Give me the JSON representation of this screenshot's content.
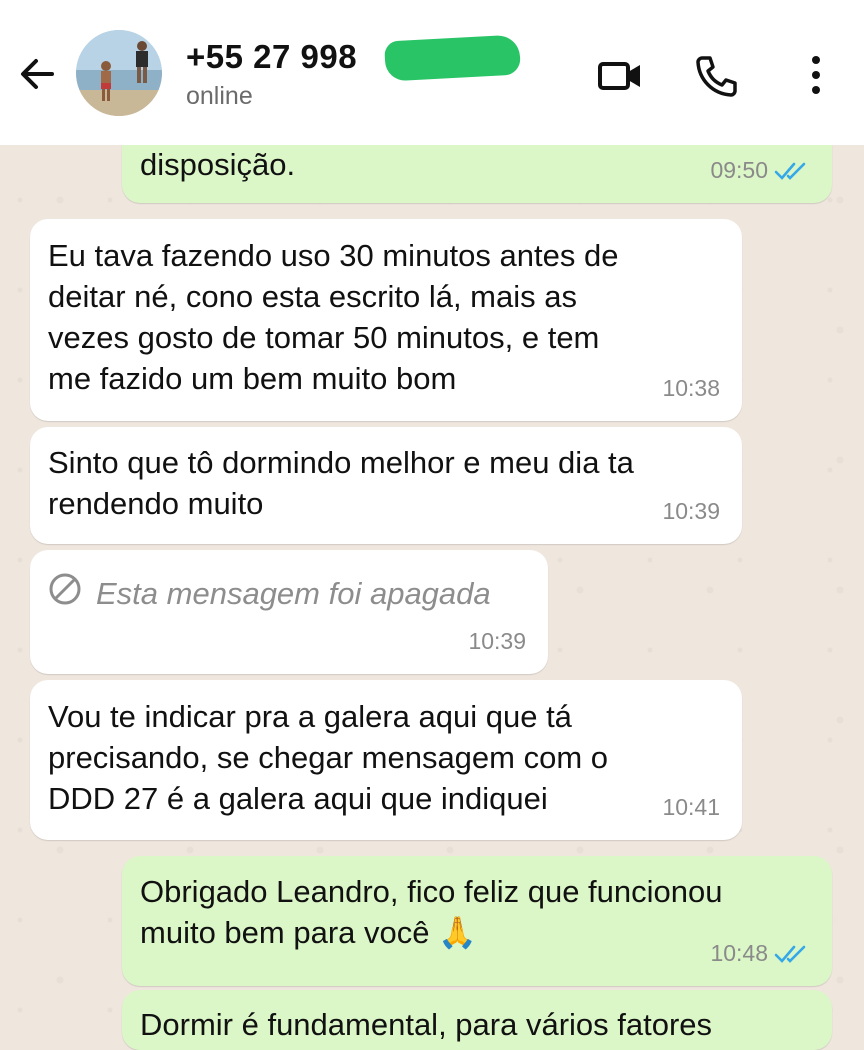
{
  "header": {
    "contact_name": "+55 27 998",
    "status": "online"
  },
  "messages": [
    {
      "direction": "outgoing",
      "text": "disposição.",
      "time": "09:50",
      "status": "read"
    },
    {
      "direction": "incoming",
      "text": "Eu tava fazendo uso 30 minutos antes de\ndeitar né, cono esta escrito lá, mais as\nvezes gosto de tomar 50 minutos, e tem\nme fazido um bem muito bom",
      "time": "10:38"
    },
    {
      "direction": "incoming",
      "text": "Sinto que tô dormindo melhor e meu dia ta\nrendendo muito",
      "time": "10:39"
    },
    {
      "direction": "incoming",
      "text": "Esta mensagem foi apagada",
      "time": "10:39",
      "deleted": true
    },
    {
      "direction": "incoming",
      "text": "Vou te indicar pra a galera aqui que tá\nprecisando, se chegar mensagem com o\nDDD 27 é a galera aqui que indiquei",
      "time": "10:41"
    },
    {
      "direction": "outgoing",
      "text": "Obrigado Leandro, fico feliz que funcionou\nmuito bem para você 🙏",
      "time": "10:48",
      "status": "read"
    },
    {
      "direction": "outgoing",
      "text": "Dormir é fundamental, para vários fatores",
      "time": "",
      "partial": true
    }
  ],
  "colors": {
    "outgoing_bubble": "#dbf6c7",
    "incoming_bubble": "#ffffff",
    "read_ticks": "#34a8e8",
    "chat_background": "#efe7de"
  },
  "icons": [
    "back-arrow-icon",
    "video-call-icon",
    "phone-icon",
    "more-vert-icon",
    "double-check-icon",
    "blocked-icon"
  ]
}
